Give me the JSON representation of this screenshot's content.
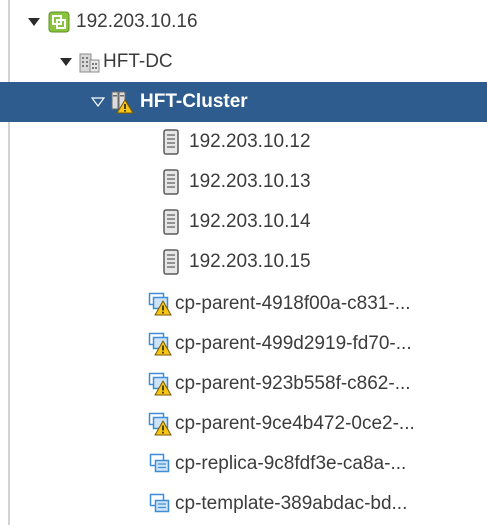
{
  "tree": {
    "vcenter": {
      "label": "192.203.10.16",
      "icon": "vcenter-icon"
    },
    "datacenter": {
      "label": "HFT-DC",
      "icon": "datacenter-icon"
    },
    "cluster": {
      "label": "HFT-Cluster",
      "icon": "cluster-warning-icon",
      "selected": true
    },
    "hosts": [
      {
        "label": "192.203.10.12",
        "icon": "host-server-icon"
      },
      {
        "label": "192.203.10.13",
        "icon": "host-server-icon"
      },
      {
        "label": "192.203.10.14",
        "icon": "host-server-icon"
      },
      {
        "label": "192.203.10.15",
        "icon": "host-server-icon"
      }
    ],
    "vms": [
      {
        "label": "cp-parent-4918f00a-c831-...",
        "icon": "vm-warning-icon"
      },
      {
        "label": "cp-parent-499d2919-fd70-...",
        "icon": "vm-warning-icon"
      },
      {
        "label": "cp-parent-923b558f-c862-...",
        "icon": "vm-warning-icon"
      },
      {
        "label": "cp-parent-9ce4b472-0ce2-...",
        "icon": "vm-warning-icon"
      },
      {
        "label": "cp-replica-9c8fdf3e-ca8a-...",
        "icon": "vm-icon"
      },
      {
        "label": "cp-template-389abdac-bd...",
        "icon": "vm-icon"
      }
    ]
  },
  "colors": {
    "selection": "#2f5c8f",
    "text": "#3c3c3c",
    "vcenter": "#8ac43f",
    "warning": "#f5c518",
    "vm": "#3d8ed6"
  }
}
